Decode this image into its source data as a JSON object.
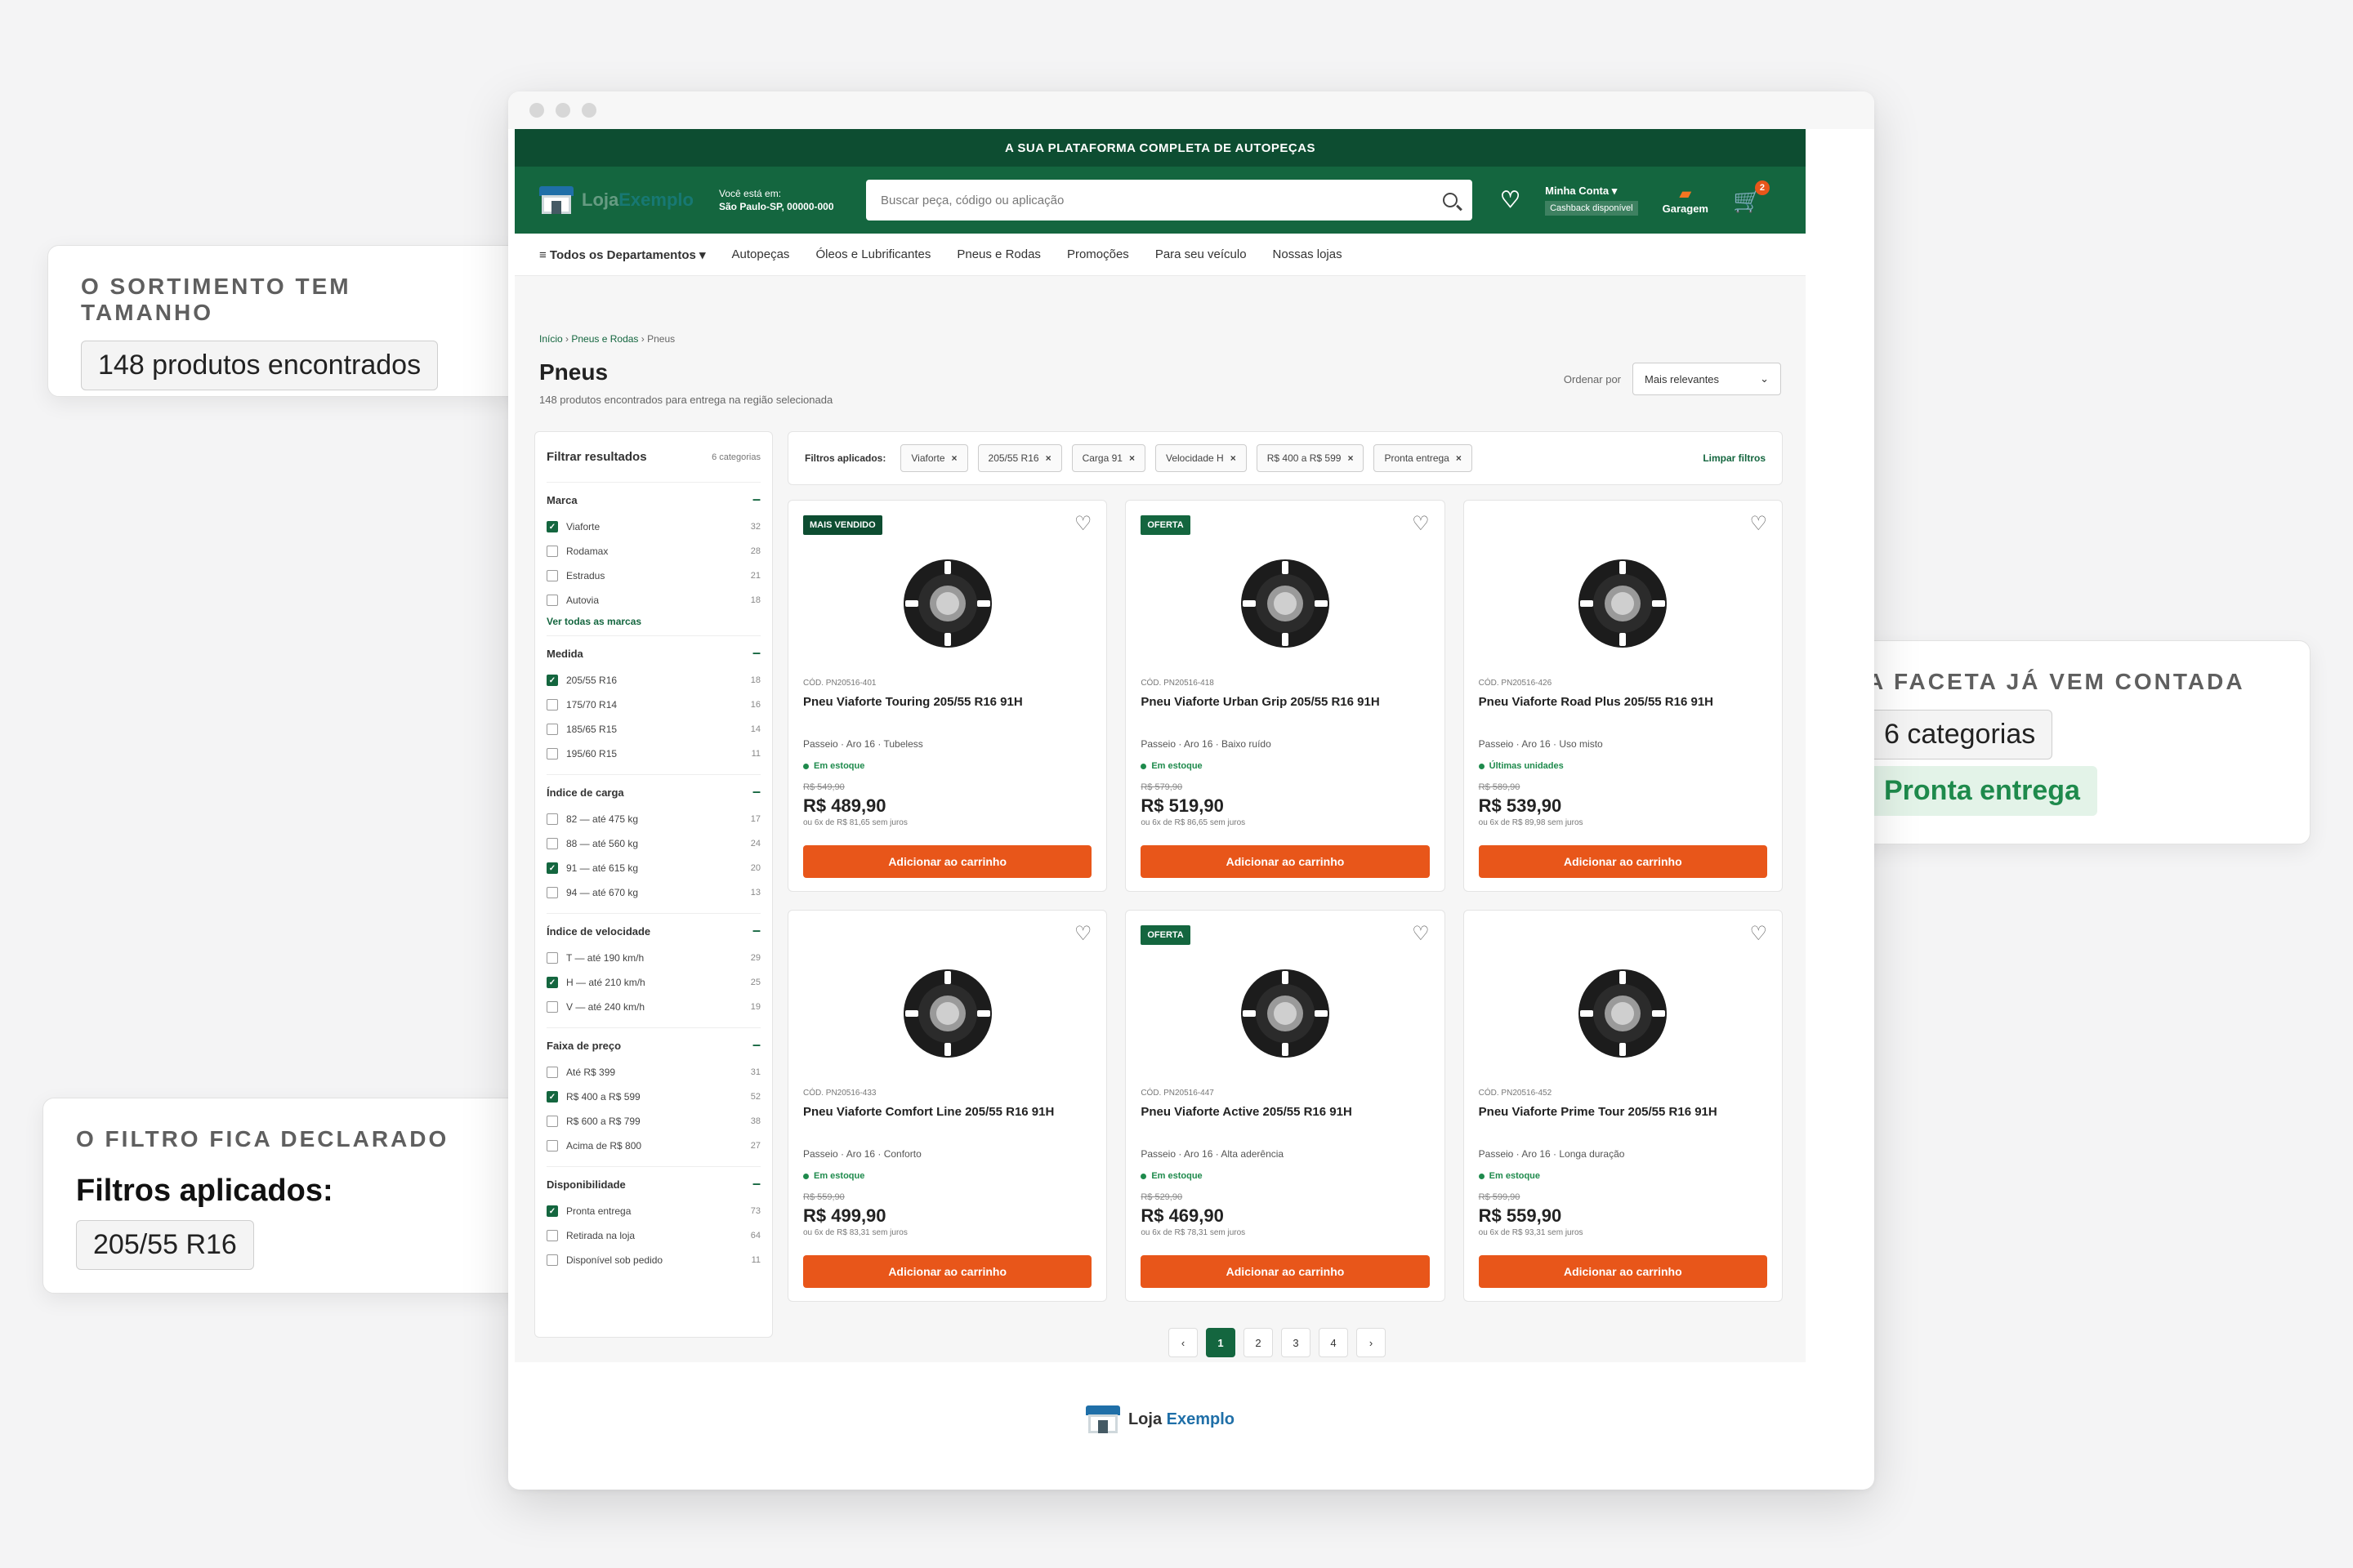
{
  "store": {
    "topbar": "A SUA PLATAFORMA COMPLETA DE AUTOPEÇAS",
    "logo_main": "Loja",
    "logo_accent": "Exemplo",
    "location_label": "Você está em:",
    "location_value": "São Paulo-SP, 00000-000",
    "search_placeholder": "Buscar peça, código ou aplicação",
    "account_label": "Minha Conta ▾",
    "cashback": "Cashback disponível",
    "garage": "Garagem",
    "cart_count": "2"
  },
  "nav": [
    "≡ Todos os Departamentos ▾",
    "Autopeças",
    "Óleos e Lubrificantes",
    "Pneus e Rodas",
    "Promoções",
    "Para seu veículo",
    "Nossas lojas"
  ],
  "breadcrumb": {
    "home": "Início",
    "sep": "›",
    "cat": "Pneus e Rodas",
    "current": "Pneus"
  },
  "page": {
    "title": "Pneus",
    "subtitle": "148 produtos encontrados para entrega na região selecionada",
    "sort_label": "Ordenar por",
    "sort_value": "Mais relevantes"
  },
  "sidebar": {
    "title": "Filtrar resultados",
    "count": "6 categorias",
    "facets": [
      {
        "title": "Marca",
        "options": [
          {
            "label": "Viaforte",
            "n": "32",
            "on": true
          },
          {
            "label": "Rodamax",
            "n": "28",
            "on": false
          },
          {
            "label": "Estradus",
            "n": "21",
            "on": false
          },
          {
            "label": "Autovia",
            "n": "18",
            "on": false
          }
        ],
        "more": "Ver todas as marcas"
      },
      {
        "title": "Medida",
        "options": [
          {
            "label": "205/55 R16",
            "n": "18",
            "on": true
          },
          {
            "label": "175/70 R14",
            "n": "16",
            "on": false
          },
          {
            "label": "185/65 R15",
            "n": "14",
            "on": false
          },
          {
            "label": "195/60 R15",
            "n": "11",
            "on": false
          }
        ]
      },
      {
        "title": "Índice de carga",
        "options": [
          {
            "label": "82 — até 475 kg",
            "n": "17",
            "on": false
          },
          {
            "label": "88 — até 560 kg",
            "n": "24",
            "on": false
          },
          {
            "label": "91 — até 615 kg",
            "n": "20",
            "on": true
          },
          {
            "label": "94 — até 670 kg",
            "n": "13",
            "on": false
          }
        ]
      },
      {
        "title": "Índice de velocidade",
        "options": [
          {
            "label": "T — até 190 km/h",
            "n": "29",
            "on": false
          },
          {
            "label": "H — até 210 km/h",
            "n": "25",
            "on": true
          },
          {
            "label": "V — até 240 km/h",
            "n": "19",
            "on": false
          }
        ]
      },
      {
        "title": "Faixa de preço",
        "options": [
          {
            "label": "Até R$ 399",
            "n": "31",
            "on": false
          },
          {
            "label": "R$ 400 a R$ 599",
            "n": "52",
            "on": true
          },
          {
            "label": "R$ 600 a R$ 799",
            "n": "38",
            "on": false
          },
          {
            "label": "Acima de R$ 800",
            "n": "27",
            "on": false
          }
        ]
      },
      {
        "title": "Disponibilidade",
        "options": [
          {
            "label": "Pronta entrega",
            "n": "73",
            "on": true
          },
          {
            "label": "Retirada na loja",
            "n": "64",
            "on": false
          },
          {
            "label": "Disponível sob pedido",
            "n": "11",
            "on": false
          }
        ]
      }
    ]
  },
  "applied": {
    "label": "Filtros aplicados:",
    "chips": [
      "Viaforte",
      "205/55 R16",
      "Carga 91",
      "Velocidade H",
      "R$ 400 a R$ 599",
      "Pronta entrega"
    ],
    "clear": "Limpar filtros"
  },
  "products": [
    {
      "badge": "MAIS VENDIDO",
      "badge_type": "best",
      "sku": "CÓD. PN20516-401",
      "name": "Pneu Viaforte Touring 205/55 R16 91H",
      "meta": "Passeio · Aro 16 · Tubeless",
      "stock": "Em estoque",
      "old": "R$ 549,90",
      "price": "R$ 489,90",
      "inst": "ou 6x de R$ 81,65 sem juros"
    },
    {
      "badge": "OFERTA",
      "badge_type": "sale",
      "sku": "CÓD. PN20516-418",
      "name": "Pneu Viaforte Urban Grip 205/55 R16 91H",
      "meta": "Passeio · Aro 16 · Baixo ruído",
      "stock": "Em estoque",
      "old": "R$ 579,90",
      "price": "R$ 519,90",
      "inst": "ou 6x de R$ 86,65 sem juros"
    },
    {
      "badge": "",
      "badge_type": "",
      "sku": "CÓD. PN20516-426",
      "name": "Pneu Viaforte Road Plus 205/55 R16 91H",
      "meta": "Passeio · Aro 16 · Uso misto",
      "stock": "Últimas unidades",
      "old": "R$ 589,90",
      "price": "R$ 539,90",
      "inst": "ou 6x de R$ 89,98 sem juros"
    },
    {
      "badge": "",
      "badge_type": "",
      "sku": "CÓD. PN20516-433",
      "name": "Pneu Viaforte Comfort Line 205/55 R16 91H",
      "meta": "Passeio · Aro 16 · Conforto",
      "stock": "Em estoque",
      "old": "R$ 559,90",
      "price": "R$ 499,90",
      "inst": "ou 6x de R$ 83,31 sem juros"
    },
    {
      "badge": "OFERTA",
      "badge_type": "sale",
      "sku": "CÓD. PN20516-447",
      "name": "Pneu Viaforte Active 205/55 R16 91H",
      "meta": "Passeio · Aro 16 · Alta aderência",
      "stock": "Em estoque",
      "old": "R$ 529,90",
      "price": "R$ 469,90",
      "inst": "ou 6x de R$ 78,31 sem juros"
    },
    {
      "badge": "",
      "badge_type": "",
      "sku": "CÓD. PN20516-452",
      "name": "Pneu Viaforte Prime Tour 205/55 R16 91H",
      "meta": "Passeio · Aro 16 · Longa duração",
      "stock": "Em estoque",
      "old": "R$ 599,90",
      "price": "R$ 559,90",
      "inst": "ou 6x de R$ 93,31 sem juros"
    }
  ],
  "add_to_cart": "Adicionar ao carrinho",
  "pagination": {
    "prev": "‹",
    "pages": [
      "1",
      "2",
      "3",
      "4"
    ],
    "next": "›",
    "current": "1"
  },
  "callouts": {
    "c1": {
      "kicker": "O SORTIMENTO TEM TAMANHO",
      "pill": "148 produtos encontrados"
    },
    "c2": {
      "kicker": "A FACETA JÁ VEM CONTADA",
      "pill": "6 categorias",
      "green": "Pronta entrega"
    },
    "c3": {
      "kicker": "O FILTRO FICA DECLARADO",
      "big": "Filtros aplicados:",
      "pill": "205/55 R16"
    }
  },
  "colors": {
    "brand": "#14663f",
    "brand_dark": "#0d4d31",
    "cta": "#e8561a",
    "stock": "#1e8a4c"
  },
  "icons": [
    "search-icon",
    "heart-icon",
    "cart-icon",
    "car-icon",
    "close-icon",
    "chevron-down-icon",
    "checkbox-checked-icon",
    "tire-icon"
  ]
}
